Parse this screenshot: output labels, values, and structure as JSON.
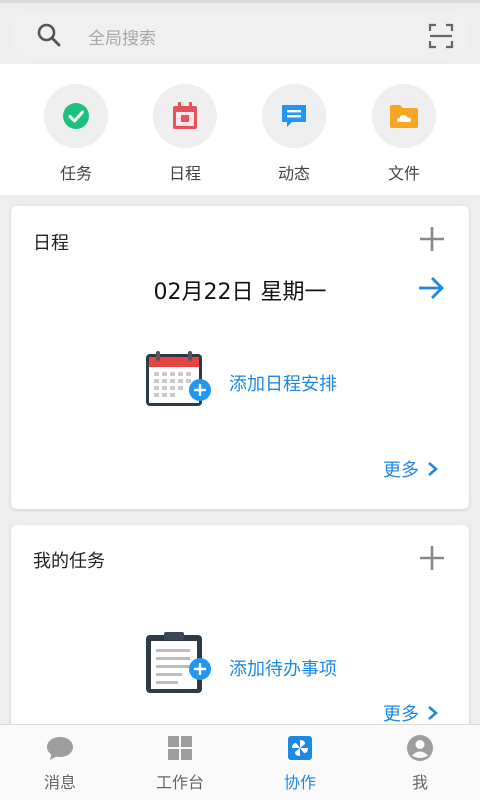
{
  "search": {
    "placeholder": "全局搜索"
  },
  "quick": [
    {
      "label": "任务",
      "icon": "check-circle-icon",
      "color": "#1ec27f"
    },
    {
      "label": "日程",
      "icon": "calendar-icon",
      "color": "#e8505b"
    },
    {
      "label": "动态",
      "icon": "message-icon",
      "color": "#2196f3"
    },
    {
      "label": "文件",
      "icon": "folder-cloud-icon",
      "color": "#f5a623"
    }
  ],
  "schedule": {
    "title": "日程",
    "date": "02月22日 星期一",
    "add_label": "添加日程安排",
    "more_label": "更多"
  },
  "tasks": {
    "title": "我的任务",
    "add_label": "添加待办事项",
    "more_label": "更多"
  },
  "nav": [
    {
      "label": "消息",
      "icon": "chat-bubble-icon"
    },
    {
      "label": "工作台",
      "icon": "grid-icon"
    },
    {
      "label": "协作",
      "icon": "pinwheel-icon",
      "active": true
    },
    {
      "label": "我",
      "icon": "user-icon"
    }
  ],
  "colors": {
    "accent": "#1e88e5",
    "icon_gray": "#9e9e9e"
  }
}
